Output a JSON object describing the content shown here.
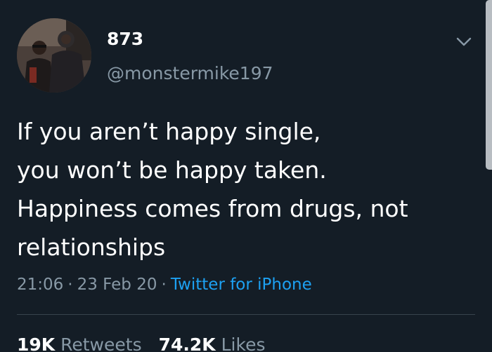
{
  "author": {
    "display_name": "873",
    "handle": "@monstermike197",
    "avatar": "profile-photo"
  },
  "tweet": {
    "text": "If you aren’t happy single,\nyou won’t be happy taken.\nHappiness comes from drugs, not\nrelationships",
    "time": "21:06",
    "separator": "·",
    "date": "23 Feb 20",
    "source": "Twitter for iPhone"
  },
  "stats": {
    "retweets_count": "19K",
    "retweets_label": "Retweets",
    "likes_count": "74.2K",
    "likes_label": "Likes"
  },
  "icons": {
    "menu": "chevron-down-icon"
  },
  "colors": {
    "background": "#141d26",
    "secondary_text": "#8899a6",
    "link": "#1da1f2",
    "divider": "#38444d"
  }
}
